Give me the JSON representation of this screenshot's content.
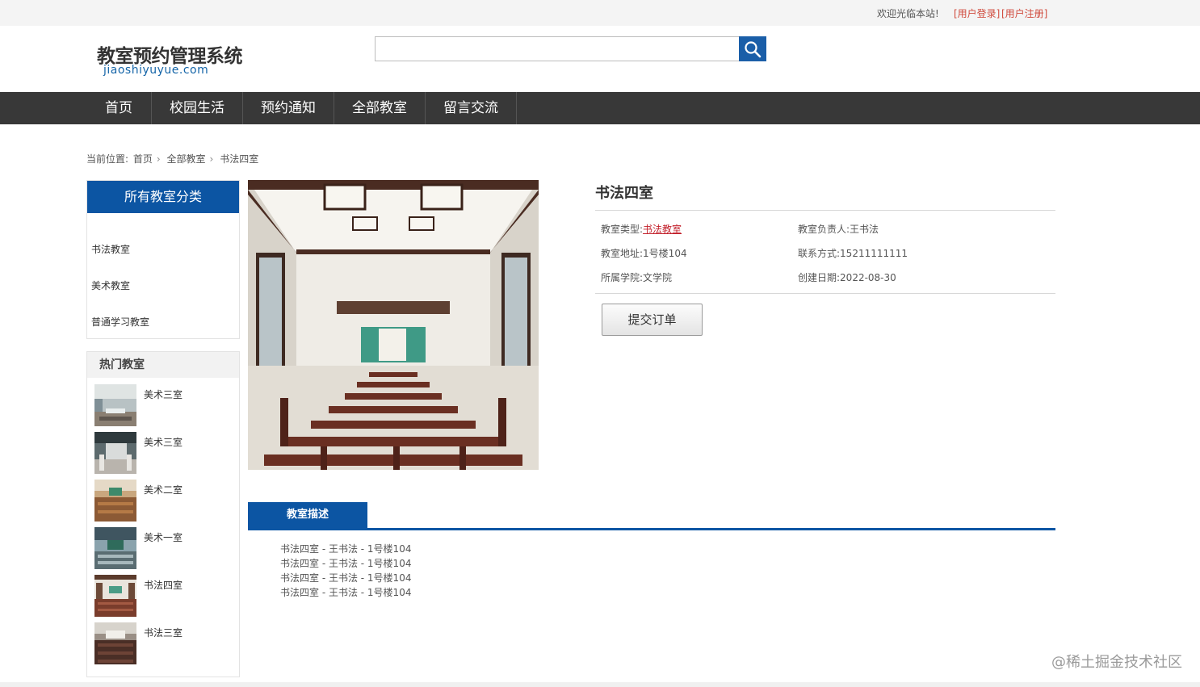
{
  "topbar": {
    "welcome": "欢迎光临本站!",
    "login": "[用户登录]",
    "register": "[用户注册]"
  },
  "header": {
    "title": "教室预约管理系统",
    "subtitle": "jiaoshiyuyue.com",
    "search_value": "",
    "search_icon": "search-icon"
  },
  "nav": {
    "items": [
      "首页",
      "校园生活",
      "预约通知",
      "全部教室",
      "留言交流"
    ]
  },
  "breadcrumb": {
    "prefix": "当前位置:",
    "items": [
      "首页",
      "全部教室",
      "书法四室"
    ]
  },
  "categories": {
    "title": "所有教室分类",
    "items": [
      "书法教室",
      "美术教室",
      "普通学习教室"
    ]
  },
  "hot": {
    "title": "热门教室",
    "items": [
      "美术三室",
      "美术三室",
      "美术二室",
      "美术一室",
      "书法四室",
      "书法三室"
    ]
  },
  "room": {
    "title": "书法四室",
    "type_label": "教室类型:",
    "type_value": "书法教室",
    "manager_label": "教室负责人:",
    "manager_value": "王书法",
    "address_label": "教室地址:",
    "address_value": "1号楼104",
    "contact_label": "联系方式:",
    "contact_value": "15211111111",
    "college_label": "所属学院:",
    "college_value": "文学院",
    "date_label": "创建日期:",
    "date_value": "2022-08-30",
    "submit": "提交订单"
  },
  "description": {
    "tab": "教室描述",
    "lines": [
      "书法四室 - 王书法 - 1号楼104",
      "书法四室 - 王书法 - 1号楼104",
      "书法四室 - 王书法 - 1号楼104",
      "书法四室 - 王书法 - 1号楼104"
    ]
  },
  "watermark": "@稀土掘金技术社区",
  "colors": {
    "primary": "#0c55a3",
    "nav_bg": "#383838",
    "link_red": "#c21f2a"
  }
}
